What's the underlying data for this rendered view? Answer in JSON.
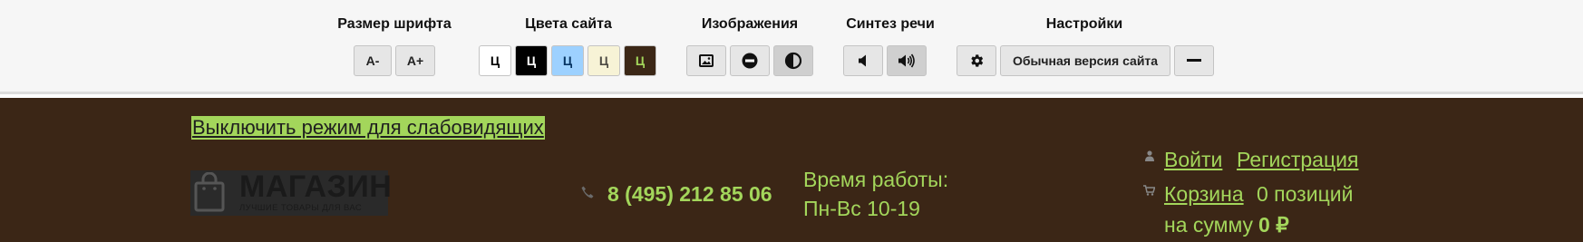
{
  "panel": {
    "font_size": {
      "title": "Размер шрифта",
      "decrease": "А-",
      "increase": "А+"
    },
    "colors": {
      "title": "Цвета сайта",
      "items": [
        {
          "label": "Ц",
          "bg": "#ffffff",
          "fg": "#000000"
        },
        {
          "label": "Ц",
          "bg": "#000000",
          "fg": "#ffffff"
        },
        {
          "label": "Ц",
          "bg": "#9dd1ff",
          "fg": "#063462"
        },
        {
          "label": "Ц",
          "bg": "#f7f3d6",
          "fg": "#4d4b43"
        },
        {
          "label": "Ц",
          "bg": "#3b2716",
          "fg": "#a3d65b"
        }
      ]
    },
    "images": {
      "title": "Изображения"
    },
    "speech": {
      "title": "Синтез речи"
    },
    "settings": {
      "title": "Настройки",
      "normal_version": "Обычная версия сайта"
    }
  },
  "header": {
    "toggle_link": "Выключить режим для слабовидящих",
    "logo": {
      "title": "МАГАЗИН",
      "subtitle": "ЛУЧШИЕ ТОВАРЫ ДЛЯ ВАС"
    },
    "phone": "8 (495) 212 85 06",
    "hours": {
      "label": "Время работы:",
      "value": "Пн-Вс 10-19"
    },
    "user": {
      "login": "Войти",
      "register": "Регистрация"
    },
    "cart": {
      "label": "Корзина",
      "count": "0 позиций",
      "sum_label": "на сумму",
      "sum_value": "0 ₽"
    }
  },
  "colors": {
    "accent": "#a3d65b",
    "background": "#3b2616",
    "panel": "#f6f6f6"
  }
}
